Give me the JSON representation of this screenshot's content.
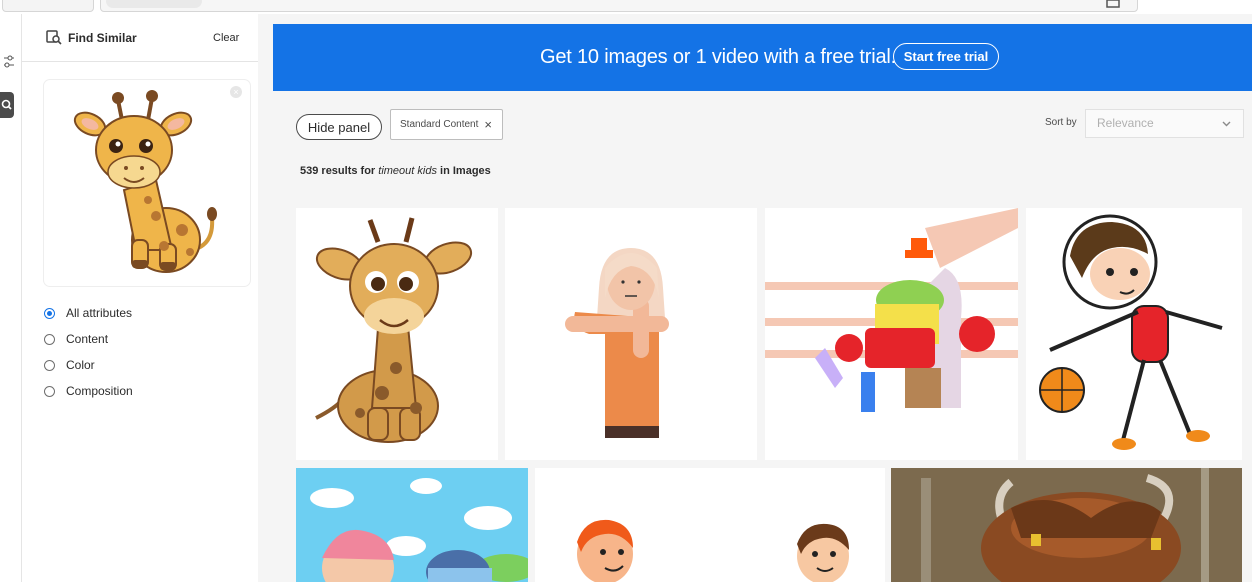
{
  "panel": {
    "title": "Find Similar",
    "clear_label": "Clear",
    "options": [
      {
        "label": "All attributes",
        "selected": true
      },
      {
        "label": "Content",
        "selected": false
      },
      {
        "label": "Color",
        "selected": false
      },
      {
        "label": "Composition",
        "selected": false
      }
    ]
  },
  "banner": {
    "text": "Get 10 images or 1 video with a free trial.",
    "cta_label": "Start free trial",
    "color": "#1473e6"
  },
  "toolbar": {
    "hide_panel_label": "Hide panel",
    "filter_chip_label": "Standard Content",
    "filter_chip_close": "×",
    "sort_label": "Sort by",
    "sort_value": "Relevance"
  },
  "results": {
    "count_prefix": "539 results for",
    "query": "timeout kids",
    "suffix": "in Images"
  },
  "icons": [
    "find-similar-icon",
    "filter-icon",
    "camera-search-icon",
    "close-icon",
    "chevron-down-icon"
  ]
}
